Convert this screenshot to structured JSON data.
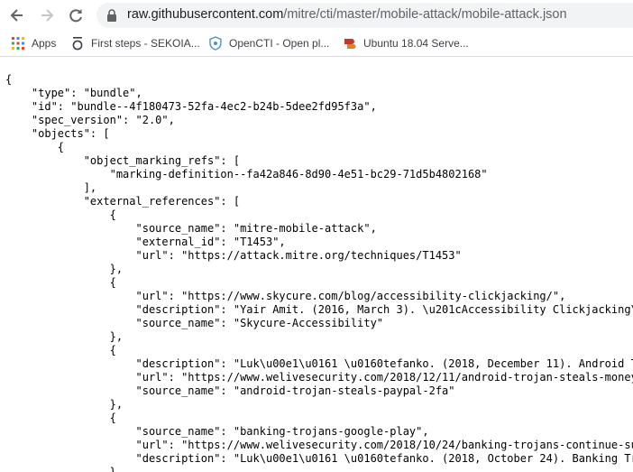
{
  "browser": {
    "url_host": "raw.githubusercontent.com",
    "url_path": "/mitre/cti/master/mobile-attack/mobile-attack.json",
    "icons": [
      "back-arrow-icon",
      "forward-arrow-icon",
      "reload-icon",
      "lock-icon"
    ]
  },
  "bookmarks": [
    {
      "label": "Apps",
      "icon": "apps-grid-icon"
    },
    {
      "label": "First steps - SEKOIA...",
      "icon": "sekoia-icon"
    },
    {
      "label": "OpenCTI - Open pl...",
      "icon": "opencti-shield-icon"
    },
    {
      "label": "Ubuntu 18.04 Serve...",
      "icon": "ubuntu-server-icon"
    }
  ],
  "colors": {
    "toolbar_bg": "#ffffff",
    "omnibox_bg": "#f1f3f4",
    "text": "#000000"
  },
  "json_lines": [
    "{",
    "    \"type\": \"bundle\",",
    "    \"id\": \"bundle--4f180473-52fa-4ec2-b24b-5dee2fd95f3a\",",
    "    \"spec_version\": \"2.0\",",
    "    \"objects\": [",
    "        {",
    "            \"object_marking_refs\": [",
    "                \"marking-definition--fa42a846-8d90-4e51-bc29-71d5b4802168\"",
    "            ],",
    "            \"external_references\": [",
    "                {",
    "                    \"source_name\": \"mitre-mobile-attack\",",
    "                    \"external_id\": \"T1453\",",
    "                    \"url\": \"https://attack.mitre.org/techniques/T1453\"",
    "                },",
    "                {",
    "                    \"url\": \"https://www.skycure.com/blog/accessibility-clickjacking/\",",
    "                    \"description\": \"Yair Amit. (2016, March 3). \\u201cAccessibility Clickjacking\\u",
    "                    \"source_name\": \"Skycure-Accessibility\"",
    "                },",
    "                {",
    "                    \"description\": \"Luk\\u00e1\\u0161 \\u0160tefanko. (2018, December 11). Android Tr",
    "                    \"url\": \"https://www.welivesecurity.com/2018/12/11/android-trojan-steals-money-",
    "                    \"source_name\": \"android-trojan-steals-paypal-2fa\"",
    "                },",
    "                {",
    "                    \"source_name\": \"banking-trojans-google-play\",",
    "                    \"url\": \"https://www.welivesecurity.com/2018/10/24/banking-trojans-continue-sur",
    "                    \"description\": \"Luk\\u00e1\\u0161 \\u0160tefanko. (2018, October 24). Banking Tro",
    "                },"
  ]
}
